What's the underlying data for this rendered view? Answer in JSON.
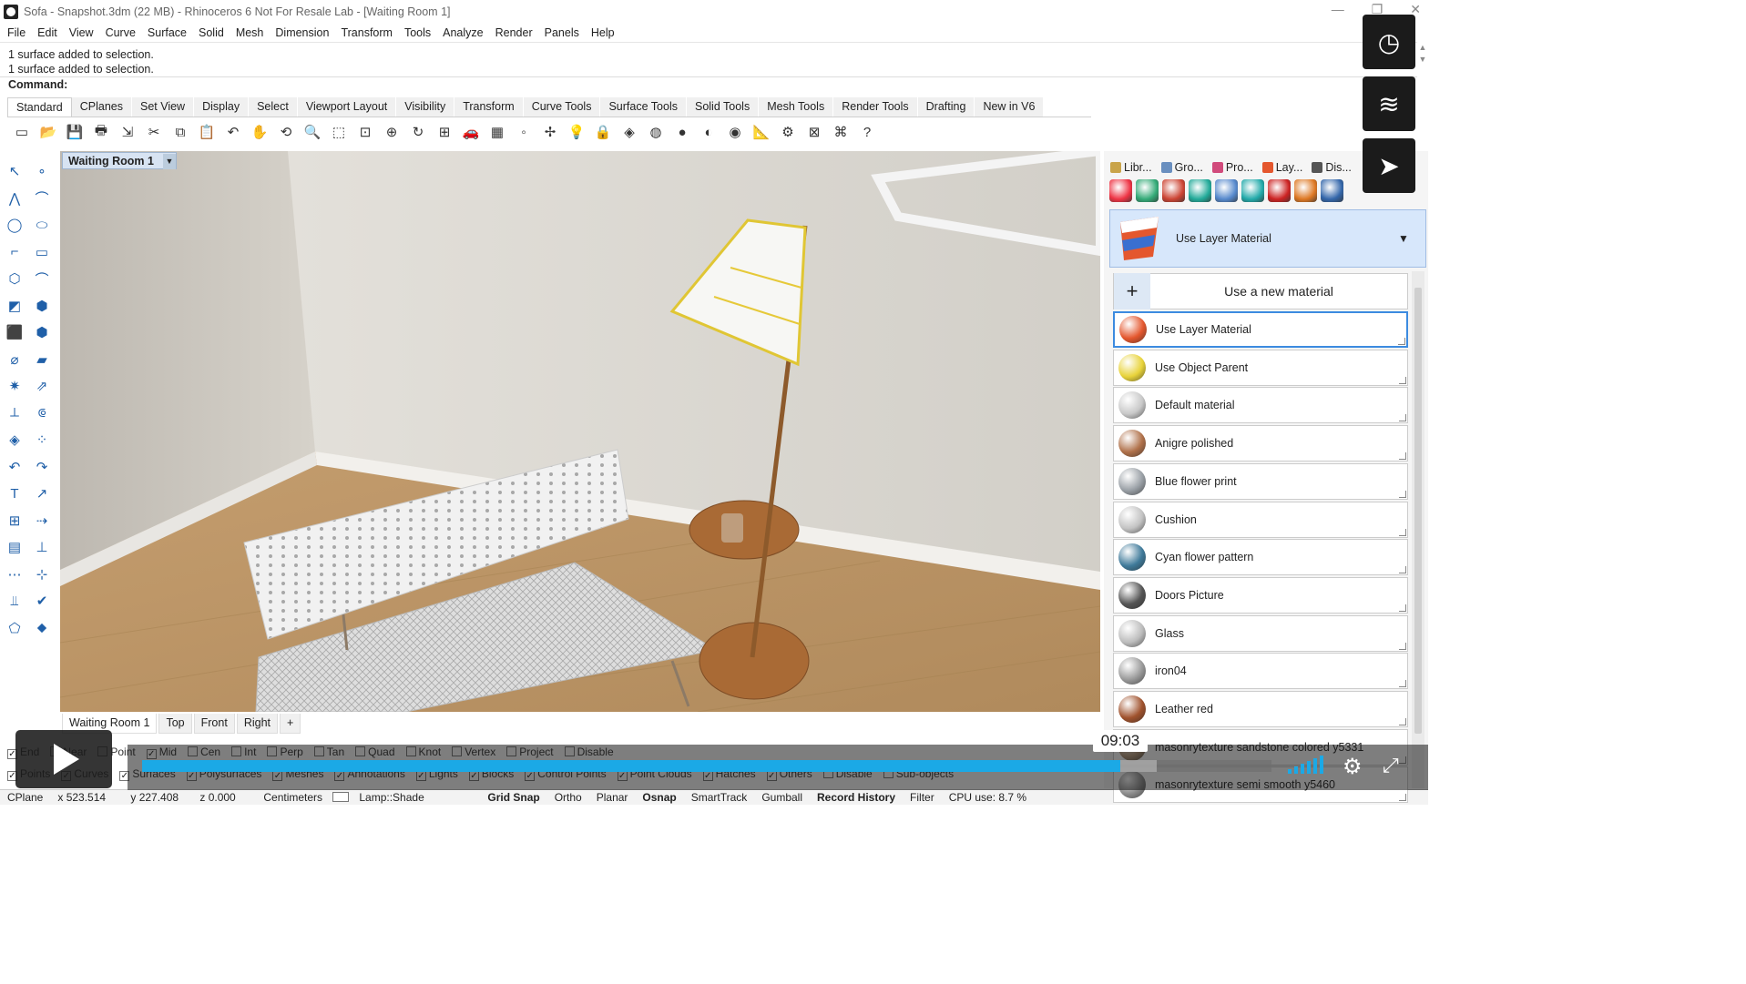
{
  "window": {
    "title": "Sofa - Snapshot.3dm (22 MB) - Rhinoceros 6 Not For Resale Lab - [Waiting Room 1]",
    "controls": [
      "—",
      "❐",
      "✕"
    ]
  },
  "menu": [
    "File",
    "Edit",
    "View",
    "Curve",
    "Surface",
    "Solid",
    "Mesh",
    "Dimension",
    "Transform",
    "Tools",
    "Analyze",
    "Render",
    "Panels",
    "Help"
  ],
  "command": {
    "history": [
      "1 surface added to selection.",
      "1 surface added to selection."
    ],
    "prompt": "Command:"
  },
  "toolbar_tabs": [
    "Standard",
    "CPlanes",
    "Set View",
    "Display",
    "Select",
    "Viewport Layout",
    "Visibility",
    "Transform",
    "Curve Tools",
    "Surface Tools",
    "Solid Tools",
    "Mesh Tools",
    "Render Tools",
    "Drafting",
    "New in V6"
  ],
  "toolbar_icons": [
    "new-file-icon",
    "open-file-icon",
    "save-icon",
    "print-icon",
    "import-icon",
    "cut-icon",
    "copy-icon",
    "paste-icon",
    "undo-icon",
    "pan-icon",
    "rotate-view-icon",
    "zoom-dynamic-icon",
    "zoom-window-icon",
    "zoom-extents-icon",
    "zoom-selected-icon",
    "rotate-icon",
    "four-viewports-icon",
    "car-icon",
    "shaded-icon",
    "point-icon",
    "move-icon",
    "light-icon",
    "lock-icon",
    "material-icon",
    "color-wheel-icon",
    "render-sphere-icon",
    "render-preview-icon",
    "render-icon",
    "tape-icon",
    "options-icon",
    "grid-icon",
    "environment-icon",
    "help-icon"
  ],
  "viewport": {
    "title": "Waiting Room 1"
  },
  "view_tabs": [
    "Waiting Room 1",
    "Top",
    "Front",
    "Right",
    "+"
  ],
  "osnap": {
    "row1": [
      {
        "label": "End",
        "on": true
      },
      {
        "label": "Near",
        "on": false
      },
      {
        "label": "Point",
        "on": false
      },
      {
        "label": "Mid",
        "on": true
      },
      {
        "label": "Cen",
        "on": false
      },
      {
        "label": "Int",
        "on": false
      },
      {
        "label": "Perp",
        "on": false
      },
      {
        "label": "Tan",
        "on": false
      },
      {
        "label": "Quad",
        "on": false
      },
      {
        "label": "Knot",
        "on": false
      },
      {
        "label": "Vertex",
        "on": false
      },
      {
        "label": "Project",
        "on": false
      },
      {
        "label": "Disable",
        "on": false
      }
    ],
    "row2": [
      {
        "label": "Points",
        "on": true
      },
      {
        "label": "Curves",
        "on": true
      },
      {
        "label": "Surfaces",
        "on": true
      },
      {
        "label": "Polysurfaces",
        "on": true
      },
      {
        "label": "Meshes",
        "on": true
      },
      {
        "label": "Annotations",
        "on": true
      },
      {
        "label": "Lights",
        "on": true
      },
      {
        "label": "Blocks",
        "on": true
      },
      {
        "label": "Control Points",
        "on": true
      },
      {
        "label": "Point Clouds",
        "on": true
      },
      {
        "label": "Hatches",
        "on": true
      },
      {
        "label": "Others",
        "on": true
      },
      {
        "label": "Disable",
        "on": false
      },
      {
        "label": "Sub-objects",
        "on": false
      }
    ]
  },
  "status": {
    "cplane": "CPlane",
    "x": "x 523.514",
    "y": "y 227.408",
    "z": "z 0.000",
    "units": "Centimeters",
    "layer": "Lamp::Shade",
    "grid_snap": "Grid Snap",
    "ortho": "Ortho",
    "planar": "Planar",
    "osnap": "Osnap",
    "smarttrack": "SmartTrack",
    "gumball": "Gumball",
    "record_history": "Record History",
    "filter": "Filter",
    "cpu": "CPU use: 8.7 %"
  },
  "panel": {
    "tabs": [
      "Libr...",
      "Gro...",
      "Pro...",
      "Lay...",
      "Dis..."
    ],
    "icon_colors": [
      "#e34",
      "#3a7",
      "#c43",
      "#2a9",
      "#58c",
      "#2aa",
      "#c22",
      "#d72",
      "#36a"
    ],
    "material_selected": "Use Layer Material",
    "new_material": "Use a new material",
    "materials": [
      {
        "name": "Use Layer Material",
        "color": "#e4572e"
      },
      {
        "name": "Use Object Parent",
        "color": "#e8d33a"
      },
      {
        "name": "Default material",
        "color": "#c9c9c9"
      },
      {
        "name": "Anigre polished",
        "color": "#b0714a"
      },
      {
        "name": "Blue flower print",
        "color": "#9aa0a6"
      },
      {
        "name": "Cushion",
        "color": "#c3c3c3"
      },
      {
        "name": "Cyan flower pattern",
        "color": "#3f7a9a"
      },
      {
        "name": "Doors Picture",
        "color": "#555555"
      },
      {
        "name": "Glass",
        "color": "#bdbdbd"
      },
      {
        "name": "iron04",
        "color": "#9a9a9a"
      },
      {
        "name": "Leather red",
        "color": "#a0522d"
      },
      {
        "name": "masonrytexture sandstone colored y5331",
        "color": "#b79a7c"
      },
      {
        "name": "masonrytexture semi smooth y5460",
        "color": "#8e8e8e"
      }
    ]
  },
  "player": {
    "time": "09:03",
    "progress": 0.866,
    "icons": [
      "clock-icon",
      "layers-icon",
      "send-icon"
    ]
  }
}
